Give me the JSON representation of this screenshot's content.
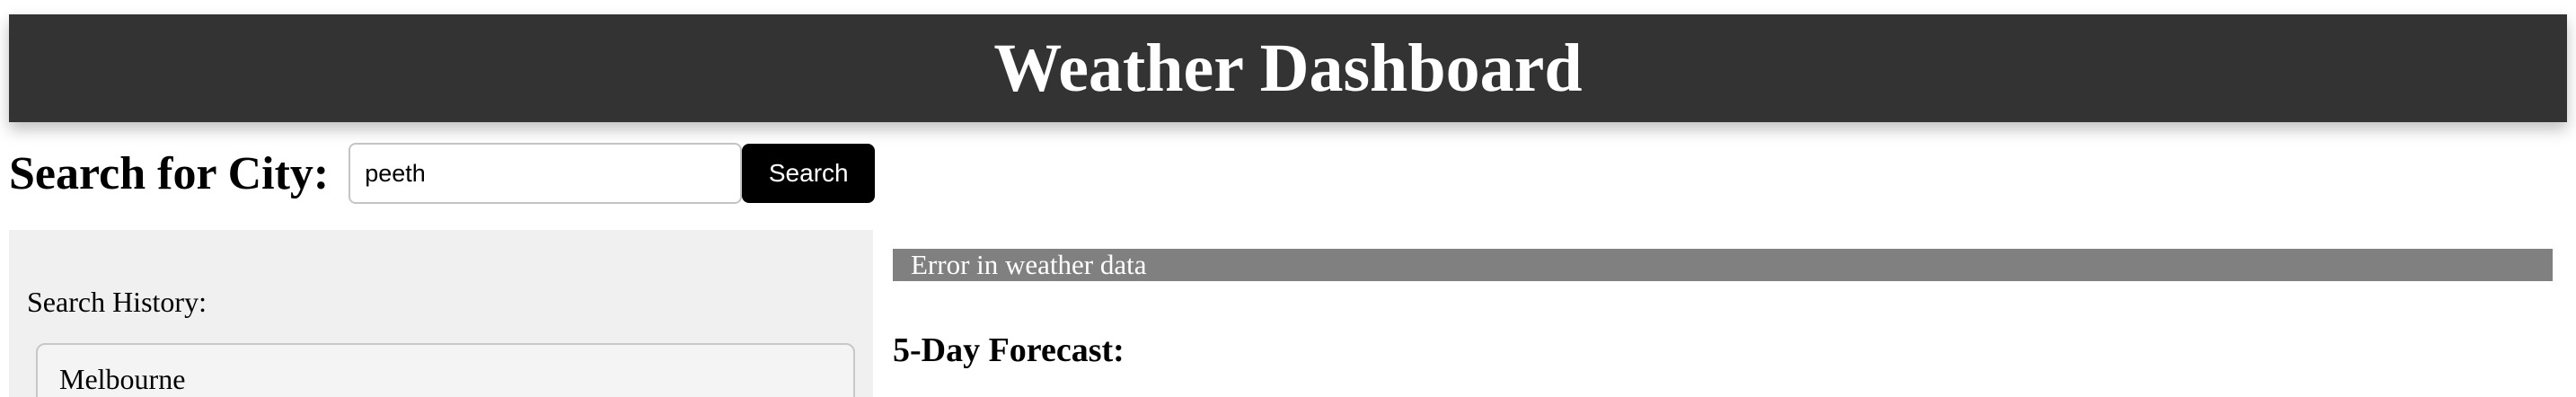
{
  "header": {
    "title": "Weather Dashboard"
  },
  "search": {
    "label": "Search for City:",
    "value": "peeth",
    "button_label": "Search"
  },
  "history": {
    "title": "Search History:",
    "items": [
      "Melbourne"
    ]
  },
  "weather": {
    "error_message": "Error in weather data",
    "forecast_title": "5-Day Forecast:"
  },
  "colors": {
    "header_bg": "#333333",
    "button_bg": "#000000",
    "history_bg": "#f0f0f0",
    "error_bg": "#808080"
  }
}
